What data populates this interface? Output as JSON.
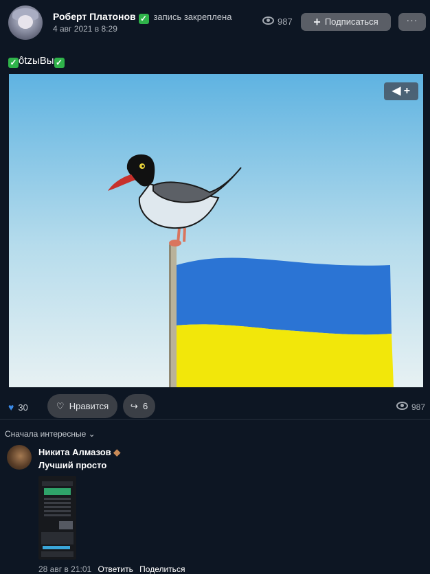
{
  "post": {
    "author": "Роберт Платонов",
    "pinned_label": "запись закреплена",
    "date": "4 авг 2021 в 8:29",
    "views": "987",
    "subscribe_label": "Подписаться",
    "more_label": "···",
    "text": "ôtzыВы"
  },
  "actions": {
    "likes_count": "30",
    "like_label": "Нравится",
    "shares_count": "6",
    "views": "987"
  },
  "comments": {
    "sort_label": "Сначала интересные",
    "items": [
      {
        "author": "Никита Алмазов",
        "text": "Лучший просто",
        "date": "28 авг в 21:01",
        "reply_label": "Ответить",
        "share_label": "Поделиться"
      }
    ]
  },
  "colors": {
    "background": "#0d1623",
    "accent": "#3b8be8",
    "flag_blue": "#2b74d4",
    "flag_yellow": "#f2e70a",
    "check_green": "#2fb34a"
  },
  "icons": [
    "eye-icon",
    "plus-icon",
    "more-icon",
    "checkmark-icon",
    "megaphone-icon",
    "heart-icon",
    "share-icon",
    "chevron-down-icon",
    "emoji-icon"
  ]
}
